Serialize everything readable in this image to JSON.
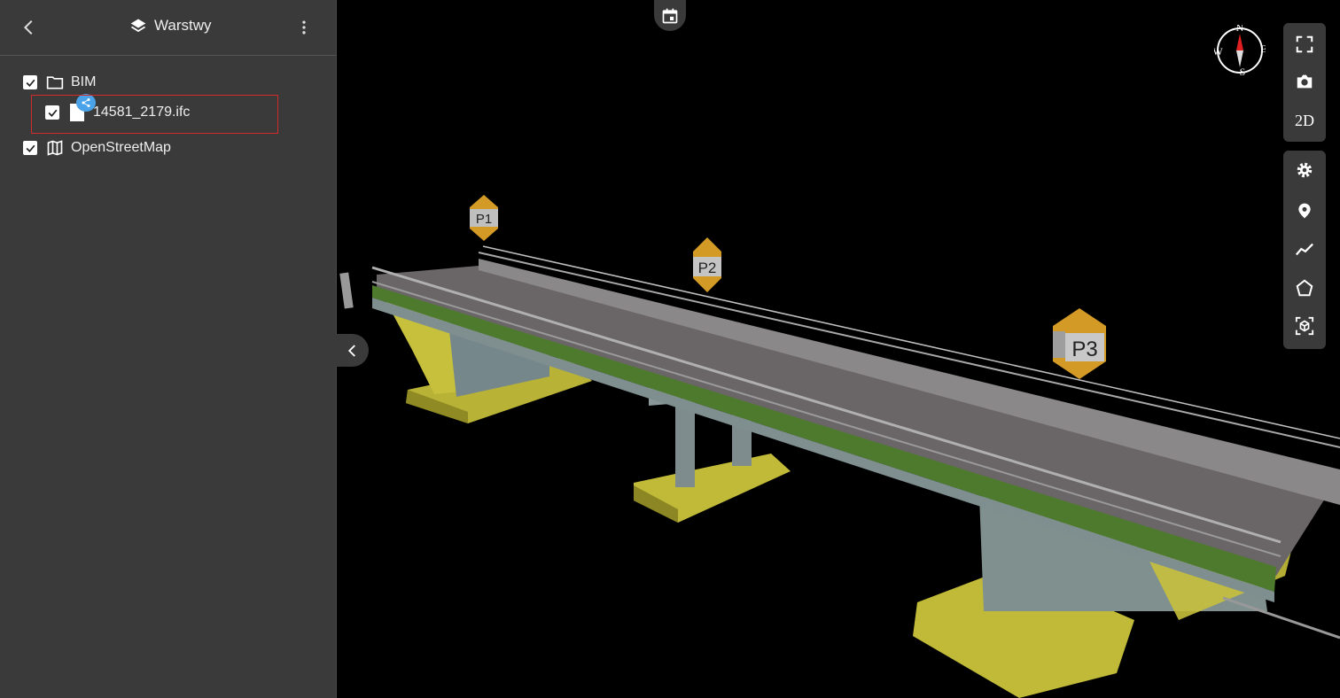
{
  "sidebar": {
    "title": "Warstwy",
    "title_icon": "layers-icon",
    "back_icon": "back-arrow-icon",
    "more_icon": "more-vertical-icon",
    "layers": [
      {
        "label": "BIM",
        "checked": true,
        "icon": "folder-icon"
      },
      {
        "label": "14581_2179.ifc",
        "checked": true,
        "icon": "file-icon",
        "shared": true
      },
      {
        "label": "OpenStreetMap",
        "checked": true,
        "icon": "map-icon"
      }
    ]
  },
  "toolbar": {
    "fullscreen_icon": "fullscreen-icon",
    "camera_icon": "camera-icon",
    "view_2d_label": "2D",
    "settings_icon": "gear-icon",
    "location_icon": "location-pin-icon",
    "polyline_icon": "polyline-icon",
    "polygon_icon": "polygon-icon",
    "cube_icon": "3d-cube-icon"
  },
  "compass": {
    "n": "N",
    "e": "E",
    "s": "S",
    "w": "W"
  },
  "scene": {
    "markers": [
      "P1",
      "P2",
      "P3"
    ],
    "colors": {
      "abutment": "#c8c23a",
      "pier": "#7d8a8c",
      "deck": "#6b6668",
      "rail": "#9a9a9a",
      "edge": "#4e7a2e"
    }
  }
}
